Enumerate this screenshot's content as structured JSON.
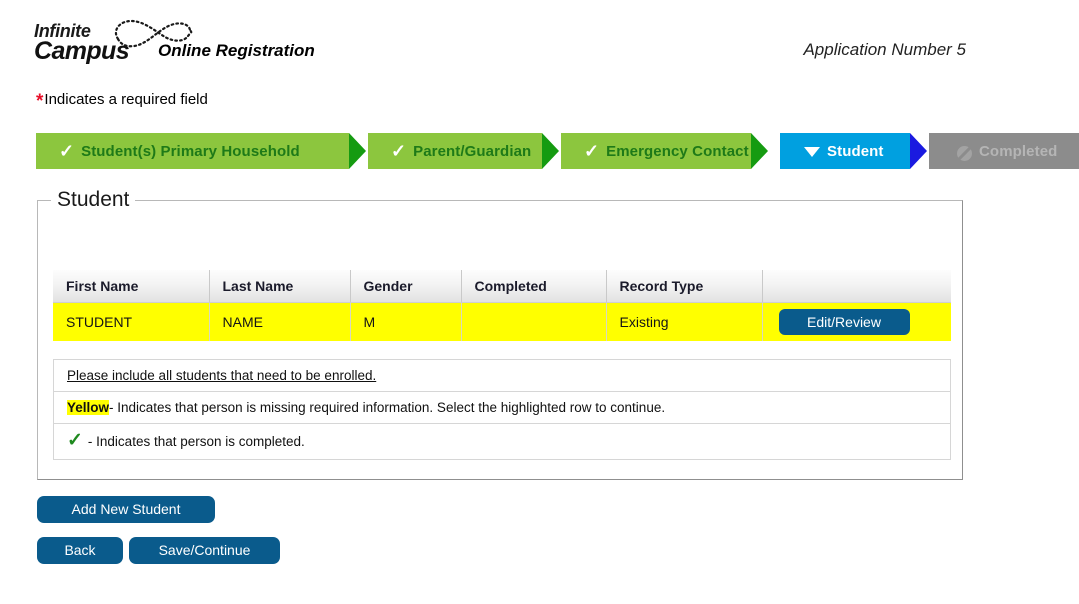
{
  "header": {
    "logo": {
      "line1": "Infinite",
      "line2": "Campus",
      "swoosh_icon": "infinity-swoosh-icon"
    },
    "product_title": "Online Registration",
    "application_number": "Application Number 5"
  },
  "required_note": {
    "asterisk": "*",
    "text": "Indicates a required field"
  },
  "steps": [
    {
      "label": "Student(s) Primary Household",
      "state": "done",
      "icon": "check-icon"
    },
    {
      "label": "Parent/Guardian",
      "state": "done",
      "icon": "check-icon"
    },
    {
      "label": "Emergency Contact",
      "state": "done",
      "icon": "check-icon"
    },
    {
      "label": "Student",
      "state": "active",
      "icon": "triangle-down-icon"
    },
    {
      "label": "Completed",
      "state": "pending",
      "icon": "no-entry-icon"
    }
  ],
  "panel": {
    "legend": "Student",
    "table": {
      "columns": [
        "First Name",
        "Last Name",
        "Gender",
        "Completed",
        "Record Type",
        ""
      ],
      "rows": [
        {
          "first_name": "STUDENT",
          "last_name": "NAME",
          "gender": "M",
          "completed": "",
          "record_type": "Existing",
          "action_label": "Edit/Review"
        }
      ]
    },
    "notes": [
      {
        "type": "underline",
        "text": "Please include all students that need to be enrolled."
      },
      {
        "type": "yellow",
        "highlight": "Yellow",
        "text": " - Indicates that person is missing required information. Select the highlighted row to continue."
      },
      {
        "type": "check",
        "icon": "green-check-icon",
        "text": " - Indicates that person is completed."
      }
    ]
  },
  "actions": {
    "add_new_student": "Add New Student",
    "back": "Back",
    "save_continue": "Save/Continue"
  },
  "colors": {
    "step_done_bg": "#8cc63e",
    "step_done_text": "#1e7a18",
    "step_active_bg": "#00a0e0",
    "step_pending_bg": "#8c8c8c",
    "row_highlight": "#ffff00",
    "button_blue": "#0a5b8c",
    "required_star": "#e8102a",
    "green_check": "#1f8a1f"
  }
}
